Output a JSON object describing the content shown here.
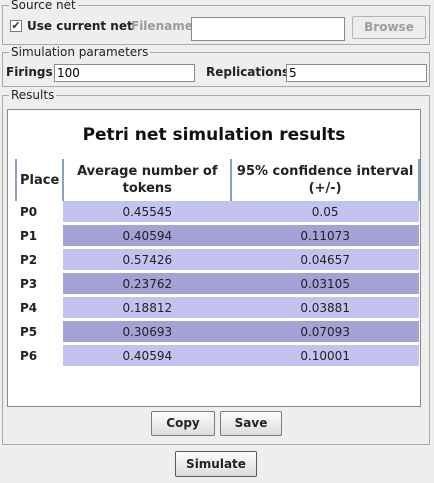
{
  "source_net": {
    "legend": "Source net",
    "use_current_net_label": "Use current net",
    "use_current_net_checked": true,
    "filename_label": "Filename:",
    "filename_value": "",
    "browse_label": "Browse"
  },
  "sim_params": {
    "legend": "Simulation parameters",
    "firings_label": "Firings:",
    "firings_value": "100",
    "replications_label": "Replications:",
    "replications_value": "5"
  },
  "results": {
    "legend": "Results",
    "title": "Petri net simulation results",
    "columns": [
      "Place",
      "Average number of tokens",
      "95% confidence interval (+/-)"
    ],
    "rows": [
      {
        "place": "P0",
        "avg": "0.45545",
        "ci": "0.05"
      },
      {
        "place": "P1",
        "avg": "0.40594",
        "ci": "0.11073"
      },
      {
        "place": "P2",
        "avg": "0.57426",
        "ci": "0.04657"
      },
      {
        "place": "P3",
        "avg": "0.23762",
        "ci": "0.03105"
      },
      {
        "place": "P4",
        "avg": "0.18812",
        "ci": "0.03881"
      },
      {
        "place": "P5",
        "avg": "0.30693",
        "ci": "0.07093"
      },
      {
        "place": "P6",
        "avg": "0.40594",
        "ci": "0.10001"
      }
    ],
    "copy_label": "Copy",
    "save_label": "Save"
  },
  "simulate_label": "Simulate",
  "colors": {
    "row_light": "#c3c3f0",
    "row_dark": "#a3a3d6",
    "grid_line": "#8aa0c4"
  }
}
